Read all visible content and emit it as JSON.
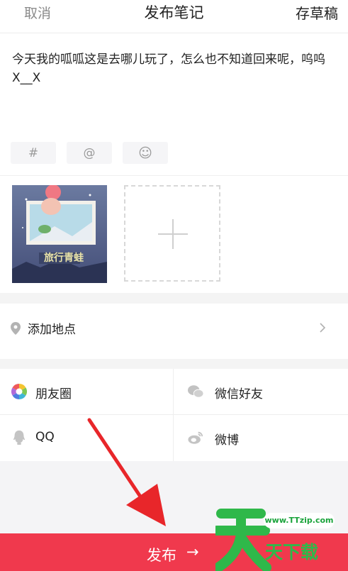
{
  "header": {
    "cancel_label": "取消",
    "title": "发布笔记",
    "draft_label": "存草稿"
  },
  "compose": {
    "content": "今天我的呱呱这是去哪儿玩了，怎么也不知道回来呢，呜呜X__X",
    "tools": [
      {
        "icon": "hashtag-icon",
        "glyph": "#"
      },
      {
        "icon": "at-icon",
        "glyph": "@"
      },
      {
        "icon": "emoji-icon",
        "glyph": "☺"
      }
    ]
  },
  "media": {
    "thumbnail_caption": "旅行青蛙",
    "add_icon": "plus-icon"
  },
  "location": {
    "label": "添加地点",
    "icon": "location-pin-icon",
    "chevron": "chevron-right-icon"
  },
  "share": {
    "items": [
      {
        "label": "朋友圈",
        "icon": "moments-icon"
      },
      {
        "label": "微信好友",
        "icon": "wechat-icon"
      },
      {
        "label": "QQ",
        "icon": "qq-icon"
      },
      {
        "label": "微博",
        "icon": "weibo-icon"
      }
    ]
  },
  "publish": {
    "label": "发布",
    "arrow": "→",
    "color": "#f0394d"
  },
  "watermark": {
    "url": "www.TTzip.com",
    "text": "天下载"
  }
}
